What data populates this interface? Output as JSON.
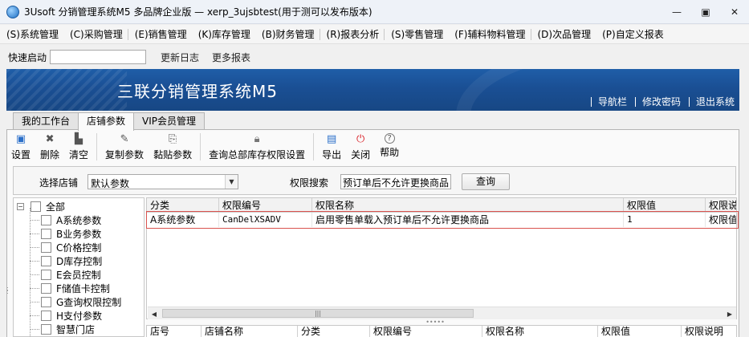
{
  "window": {
    "title": "3Usoft 分销管理系统M5 多品牌企业版 — xerp_3ujsbtest(用于测可以发布版本)",
    "controls": [
      "▭",
      "⧉",
      "✕"
    ]
  },
  "menu": [
    {
      "label": "(S)系统管理"
    },
    {
      "label": "(C)采购管理"
    },
    {
      "label": "(E)销售管理"
    },
    {
      "label": "(K)库存管理"
    },
    {
      "label": "(B)财务管理"
    },
    {
      "label": "(R)报表分析"
    },
    {
      "label": "(S)零售管理"
    },
    {
      "label": "(F)辅料物料管理"
    },
    {
      "label": "(D)次品管理"
    },
    {
      "label": "(P)自定义报表"
    }
  ],
  "quick": {
    "label": "快速启动",
    "input_value": "",
    "links": [
      "更新日志",
      "更多报表"
    ]
  },
  "banner": {
    "title": "三联分销管理系统M5",
    "links": [
      "导航栏",
      "修改密码",
      "退出系统"
    ]
  },
  "tabs": [
    {
      "label": "我的工作台",
      "active": false
    },
    {
      "label": "店铺参数",
      "active": true
    },
    {
      "label": "VIP会员管理",
      "active": false
    }
  ],
  "toolbar": [
    {
      "label": "设置",
      "icon": "save-icon",
      "glyph": "💾",
      "color": "#2a6fc9"
    },
    {
      "label": "删除",
      "icon": "delete-icon",
      "glyph": "✖",
      "color": "#555555"
    },
    {
      "label": "清空",
      "icon": "trash-icon",
      "glyph": "🗑",
      "color": "#555555"
    },
    {
      "label": "复制参数",
      "icon": "copy-icon",
      "glyph": "✎",
      "color": "#555555"
    },
    {
      "label": "黏贴参数",
      "icon": "paste-icon",
      "glyph": "⎘",
      "color": "#555555"
    },
    {
      "label": "查询总部库存权限设置",
      "icon": "lock-icon",
      "glyph": "🔒",
      "color": "#777777"
    },
    {
      "label": "导出",
      "icon": "export-icon",
      "glyph": "▤",
      "color": "#2a6fc9"
    },
    {
      "label": "关闭",
      "icon": "power-icon",
      "glyph": "⏻",
      "color": "#d9232a"
    },
    {
      "label": "帮助",
      "icon": "help-icon",
      "glyph": "?",
      "color": "#555555"
    }
  ],
  "filter": {
    "store_label": "选择店铺",
    "store_value": "默认参数",
    "search_label": "权限搜索",
    "search_value": "预订单后不允许更换商品",
    "query_button": "查询"
  },
  "tree": {
    "root": "全部",
    "items": [
      "A系统参数",
      "B业务参数",
      "C价格控制",
      "D库存控制",
      "E会员控制",
      "F储值卡控制",
      "G查询权限控制",
      "H支付参数",
      "智慧门店"
    ]
  },
  "grid": {
    "columns": [
      "分类",
      "权限编号",
      "权限名称",
      "权限值",
      "权限说"
    ],
    "rows": [
      {
        "category": "A系统参数",
        "code": "CanDelXSADV",
        "name": "启用零售单载入预订单后不允许更换商品",
        "value": "1",
        "desc": "权限值"
      }
    ]
  },
  "grid2": {
    "columns": [
      "店号",
      "店铺名称",
      "分类",
      "权限编号",
      "权限名称",
      "权限值",
      "权限说明"
    ]
  },
  "colors": {
    "banner": "#1a4f94",
    "highlight_border": "#d9534f"
  }
}
